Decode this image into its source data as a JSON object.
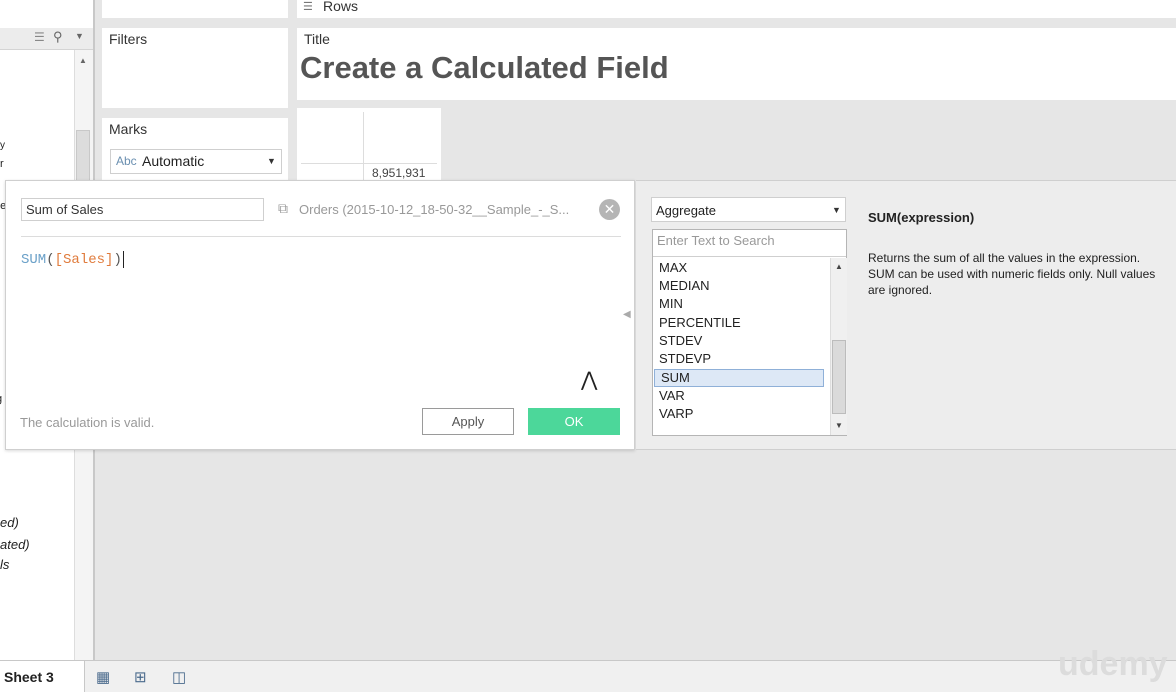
{
  "shelves": {
    "rows_label": "Rows",
    "filters_label": "Filters",
    "marks_label": "Marks",
    "marks_type_prefix": "Abc",
    "marks_type": "Automatic",
    "title_label": "Title",
    "title_text": "Create a Calculated Field"
  },
  "left_pane": {
    "partial_fields": [
      "y",
      "r",
      "ge",
      "g",
      "r",
      "ed)",
      "ated)",
      "ls"
    ]
  },
  "table": {
    "value": "8,951,931"
  },
  "calc_dialog": {
    "name_value": "Sum of Sales",
    "datasource": "Orders (2015-10-12_18-50-32__Sample_-_S...",
    "formula_fn": "SUM",
    "formula_open": "(",
    "formula_field": "[Sales]",
    "formula_close": ")",
    "status": "The calculation is valid.",
    "apply_label": "Apply",
    "ok_label": "OK"
  },
  "functions_panel": {
    "category": "Aggregate",
    "search_placeholder": "Enter Text to Search",
    "items": [
      "MAX",
      "MEDIAN",
      "MIN",
      "PERCENTILE",
      "STDEV",
      "STDEVP",
      "SUM",
      "VAR",
      "VARP"
    ],
    "selected": "SUM",
    "help_title": "SUM(expression)",
    "help_text": "Returns the sum of all the values in the expression. SUM can be used with numeric fields only. Null values are ignored."
  },
  "bottom_bar": {
    "sheet_tab": "Sheet 3",
    "watermark": "udemy"
  },
  "colors": {
    "ok_green": "#4cd79a",
    "formula_fn": "#6aa0c8",
    "formula_field": "#e07b3c",
    "selection": "#dde8f6"
  }
}
